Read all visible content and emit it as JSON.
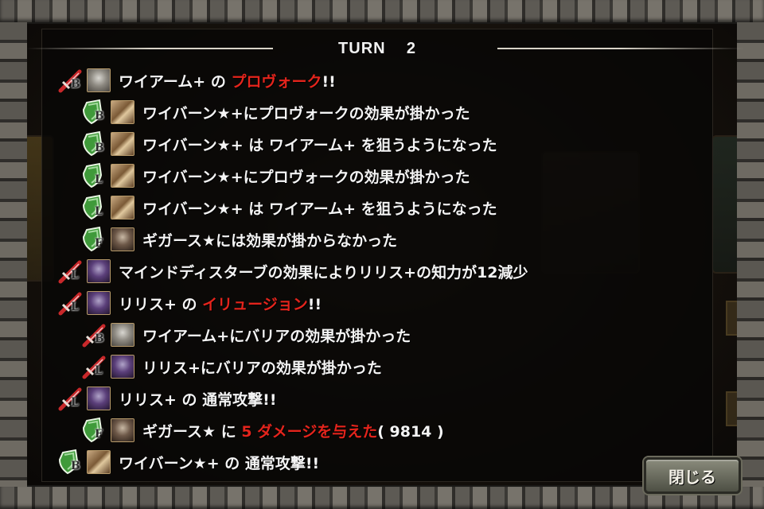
{
  "turn": {
    "label": "TURN",
    "number": "2"
  },
  "close_button": "閉じる",
  "log": [
    {
      "indent": false,
      "role": "attack",
      "letter": "B",
      "portrait": "wyarm",
      "parts": [
        {
          "t": "ワイアーム+ の "
        },
        {
          "t": "プロヴォーク",
          "red": true
        },
        {
          "t": "!!"
        }
      ]
    },
    {
      "indent": true,
      "role": "defense",
      "letter": "B",
      "portrait": "wyvern",
      "parts": [
        {
          "t": "ワイバーン★+にプロヴォークの効果が掛かった"
        }
      ]
    },
    {
      "indent": true,
      "role": "defense",
      "letter": "B",
      "portrait": "wyvern",
      "parts": [
        {
          "t": "ワイバーン★+ は ワイアーム+ を狙うようになった"
        }
      ]
    },
    {
      "indent": true,
      "role": "defense",
      "letter": "L",
      "portrait": "wyvern",
      "parts": [
        {
          "t": "ワイバーン★+にプロヴォークの効果が掛かった"
        }
      ]
    },
    {
      "indent": true,
      "role": "defense",
      "letter": "L",
      "portrait": "wyvern",
      "parts": [
        {
          "t": "ワイバーン★+ は ワイアーム+ を狙うようになった"
        }
      ]
    },
    {
      "indent": true,
      "role": "defense",
      "letter": "F",
      "portrait": "gigas",
      "parts": [
        {
          "t": "ギガース★には効果が掛からなかった"
        }
      ]
    },
    {
      "indent": false,
      "role": "attack",
      "letter": "L",
      "portrait": "lilith",
      "parts": [
        {
          "t": "マインドディスターブの効果によりリリス+の知力が12減少"
        }
      ]
    },
    {
      "indent": false,
      "role": "attack",
      "letter": "L",
      "portrait": "lilith",
      "parts": [
        {
          "t": "リリス+ の "
        },
        {
          "t": "イリュージョン",
          "red": true
        },
        {
          "t": "!!"
        }
      ]
    },
    {
      "indent": true,
      "role": "attack",
      "letter": "B",
      "portrait": "wyarm",
      "parts": [
        {
          "t": "ワイアーム+にバリアの効果が掛かった"
        }
      ]
    },
    {
      "indent": true,
      "role": "attack",
      "letter": "L",
      "portrait": "lilith",
      "parts": [
        {
          "t": "リリス+にバリアの効果が掛かった"
        }
      ]
    },
    {
      "indent": false,
      "role": "attack",
      "letter": "L",
      "portrait": "lilith",
      "parts": [
        {
          "t": "リリス+ の 通常攻撃!!"
        }
      ]
    },
    {
      "indent": true,
      "role": "defense",
      "letter": "F",
      "portrait": "gigas",
      "parts": [
        {
          "t": "ギガース★ に "
        },
        {
          "t": "5 ダメージを与えた",
          "red": true
        },
        {
          "t": "( 9814 )"
        }
      ]
    },
    {
      "indent": false,
      "role": "defense",
      "letter": "B",
      "portrait": "wyvern",
      "parts": [
        {
          "t": "ワイバーン★+ の 通常攻撃!!"
        }
      ]
    }
  ],
  "icons": {
    "attack": "sword-icon",
    "defense": "shield-icon"
  },
  "colors": {
    "highlight": "#e4241c",
    "text": "#f4f4f4",
    "shield": "#3f9a3a",
    "sword": "#c8282a"
  }
}
